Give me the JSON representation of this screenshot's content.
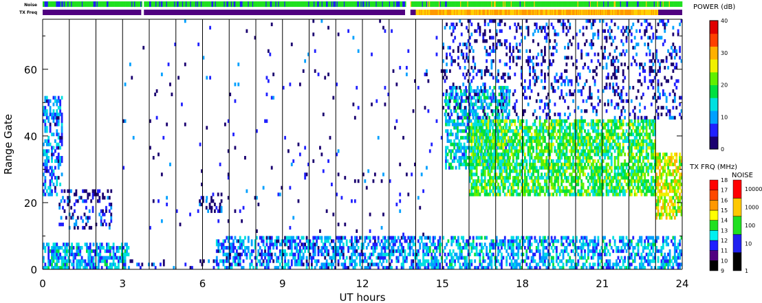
{
  "chart_data": {
    "type": "heatmap",
    "xlabel": "UT hours",
    "ylabel": "Range Gate",
    "xlim": [
      0,
      24
    ],
    "ylim": [
      0,
      75
    ],
    "xticks": [
      "0",
      "3",
      "6",
      "9",
      "12",
      "15",
      "18",
      "21",
      "24"
    ],
    "yticks": [
      "0",
      "20",
      "40",
      "60"
    ],
    "scan_lines_hours": [
      1,
      2,
      3,
      4,
      5,
      6,
      7,
      8,
      9,
      10,
      11,
      12,
      13,
      14,
      15,
      16,
      17,
      18,
      19,
      20,
      21,
      22,
      23
    ],
    "noise_label": "Noise",
    "txfreq_label": "TX Freq",
    "power_colorbar": {
      "title": "POWER (dB)",
      "range": [
        0,
        40
      ],
      "ticks": [
        "0",
        "10",
        "20",
        "30",
        "40"
      ],
      "colors": [
        "#1a0070",
        "#2020ff",
        "#00a0ff",
        "#00e0e0",
        "#00e040",
        "#60f000",
        "#f0f000",
        "#ffb000",
        "#ff4000",
        "#e00000"
      ]
    },
    "txfreq_colorbar": {
      "title": "TX FRQ (MHz)",
      "ticks": [
        "9",
        "10",
        "11",
        "12",
        "13",
        "14",
        "15",
        "16",
        "17",
        "18"
      ],
      "colors": [
        "#000000",
        "#500080",
        "#2020ff",
        "#00f0f0",
        "#20e020",
        "#ffff00",
        "#ff9800",
        "#ff4800",
        "#ff0000"
      ]
    },
    "noise_colorbar": {
      "title": "NOISE",
      "ticks": [
        "1",
        "10",
        "100",
        "1000",
        "10000"
      ],
      "colors": [
        "#000000",
        "#2020f0",
        "#20e020",
        "#ffc800",
        "#ff0000"
      ]
    },
    "noise_segments": [
      {
        "from": 0,
        "to": 3.7,
        "level": "mixed-blue"
      },
      {
        "from": 3.8,
        "to": 13.6,
        "level": "mixed-blue"
      },
      {
        "from": 13.8,
        "to": 24,
        "level": "mostly-green"
      }
    ],
    "txfreq_segments": [
      {
        "from": 0,
        "to": 3.7,
        "mhz": 10
      },
      {
        "from": 3.8,
        "to": 13.6,
        "mhz": 10
      },
      {
        "from": 13.8,
        "to": 14,
        "mhz": 10
      },
      {
        "from": 14,
        "to": 23.1,
        "mhz": 14.5
      },
      {
        "from": 23.1,
        "to": 24,
        "mhz": 10
      }
    ],
    "echo_regions": [
      {
        "ut": [
          0,
          0.7
        ],
        "gates": [
          22,
          52
        ],
        "power": 8,
        "density": 0.55
      },
      {
        "ut": [
          0.6,
          2.6
        ],
        "gates": [
          12,
          24
        ],
        "power": 4,
        "density": 0.3
      },
      {
        "ut": [
          0,
          3.2
        ],
        "gates": [
          0,
          8
        ],
        "power": 10,
        "density": 0.7
      },
      {
        "ut": [
          3.2,
          6.5
        ],
        "gates": [
          0,
          3
        ],
        "power": 4,
        "density": 0.15
      },
      {
        "ut": [
          5.8,
          6.7
        ],
        "gates": [
          17,
          23
        ],
        "power": 4,
        "density": 0.35
      },
      {
        "ut": [
          6.5,
          14.5
        ],
        "gates": [
          0,
          10
        ],
        "power": 8,
        "density": 0.55
      },
      {
        "ut": [
          14.5,
          24
        ],
        "gates": [
          0,
          10
        ],
        "power": 10,
        "density": 0.55
      },
      {
        "ut": [
          15.1,
          17.5
        ],
        "gates": [
          30,
          55
        ],
        "power": 12,
        "density": 0.55
      },
      {
        "ut": [
          16,
          23
        ],
        "gates": [
          22,
          45
        ],
        "power": 18,
        "density": 0.7
      },
      {
        "ut": [
          23,
          24
        ],
        "gates": [
          15,
          35
        ],
        "power": 24,
        "density": 0.65
      },
      {
        "ut": [
          15,
          24
        ],
        "gates": [
          45,
          75
        ],
        "power": 4,
        "density": 0.22
      },
      {
        "ut": [
          3,
          15
        ],
        "gates": [
          10,
          75
        ],
        "power": 3,
        "density": 0.02
      }
    ]
  }
}
